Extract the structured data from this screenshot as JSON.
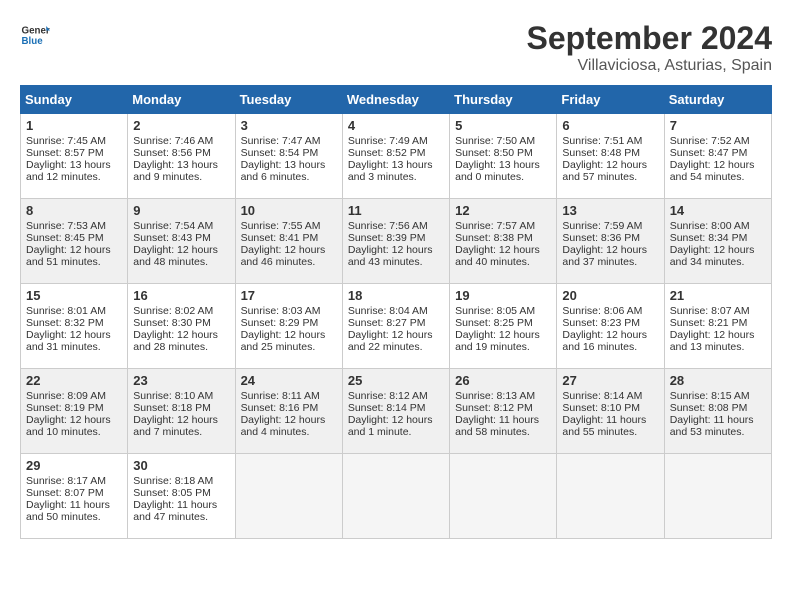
{
  "header": {
    "logo_line1": "General",
    "logo_line2": "Blue",
    "month": "September 2024",
    "location": "Villaviciosa, Asturias, Spain"
  },
  "days_of_week": [
    "Sunday",
    "Monday",
    "Tuesday",
    "Wednesday",
    "Thursday",
    "Friday",
    "Saturday"
  ],
  "weeks": [
    [
      {
        "day": "1",
        "lines": [
          "Sunrise: 7:45 AM",
          "Sunset: 8:57 PM",
          "Daylight: 13 hours",
          "and 12 minutes."
        ]
      },
      {
        "day": "2",
        "lines": [
          "Sunrise: 7:46 AM",
          "Sunset: 8:56 PM",
          "Daylight: 13 hours",
          "and 9 minutes."
        ]
      },
      {
        "day": "3",
        "lines": [
          "Sunrise: 7:47 AM",
          "Sunset: 8:54 PM",
          "Daylight: 13 hours",
          "and 6 minutes."
        ]
      },
      {
        "day": "4",
        "lines": [
          "Sunrise: 7:49 AM",
          "Sunset: 8:52 PM",
          "Daylight: 13 hours",
          "and 3 minutes."
        ]
      },
      {
        "day": "5",
        "lines": [
          "Sunrise: 7:50 AM",
          "Sunset: 8:50 PM",
          "Daylight: 13 hours",
          "and 0 minutes."
        ]
      },
      {
        "day": "6",
        "lines": [
          "Sunrise: 7:51 AM",
          "Sunset: 8:48 PM",
          "Daylight: 12 hours",
          "and 57 minutes."
        ]
      },
      {
        "day": "7",
        "lines": [
          "Sunrise: 7:52 AM",
          "Sunset: 8:47 PM",
          "Daylight: 12 hours",
          "and 54 minutes."
        ]
      }
    ],
    [
      {
        "day": "8",
        "lines": [
          "Sunrise: 7:53 AM",
          "Sunset: 8:45 PM",
          "Daylight: 12 hours",
          "and 51 minutes."
        ]
      },
      {
        "day": "9",
        "lines": [
          "Sunrise: 7:54 AM",
          "Sunset: 8:43 PM",
          "Daylight: 12 hours",
          "and 48 minutes."
        ]
      },
      {
        "day": "10",
        "lines": [
          "Sunrise: 7:55 AM",
          "Sunset: 8:41 PM",
          "Daylight: 12 hours",
          "and 46 minutes."
        ]
      },
      {
        "day": "11",
        "lines": [
          "Sunrise: 7:56 AM",
          "Sunset: 8:39 PM",
          "Daylight: 12 hours",
          "and 43 minutes."
        ]
      },
      {
        "day": "12",
        "lines": [
          "Sunrise: 7:57 AM",
          "Sunset: 8:38 PM",
          "Daylight: 12 hours",
          "and 40 minutes."
        ]
      },
      {
        "day": "13",
        "lines": [
          "Sunrise: 7:59 AM",
          "Sunset: 8:36 PM",
          "Daylight: 12 hours",
          "and 37 minutes."
        ]
      },
      {
        "day": "14",
        "lines": [
          "Sunrise: 8:00 AM",
          "Sunset: 8:34 PM",
          "Daylight: 12 hours",
          "and 34 minutes."
        ]
      }
    ],
    [
      {
        "day": "15",
        "lines": [
          "Sunrise: 8:01 AM",
          "Sunset: 8:32 PM",
          "Daylight: 12 hours",
          "and 31 minutes."
        ]
      },
      {
        "day": "16",
        "lines": [
          "Sunrise: 8:02 AM",
          "Sunset: 8:30 PM",
          "Daylight: 12 hours",
          "and 28 minutes."
        ]
      },
      {
        "day": "17",
        "lines": [
          "Sunrise: 8:03 AM",
          "Sunset: 8:29 PM",
          "Daylight: 12 hours",
          "and 25 minutes."
        ]
      },
      {
        "day": "18",
        "lines": [
          "Sunrise: 8:04 AM",
          "Sunset: 8:27 PM",
          "Daylight: 12 hours",
          "and 22 minutes."
        ]
      },
      {
        "day": "19",
        "lines": [
          "Sunrise: 8:05 AM",
          "Sunset: 8:25 PM",
          "Daylight: 12 hours",
          "and 19 minutes."
        ]
      },
      {
        "day": "20",
        "lines": [
          "Sunrise: 8:06 AM",
          "Sunset: 8:23 PM",
          "Daylight: 12 hours",
          "and 16 minutes."
        ]
      },
      {
        "day": "21",
        "lines": [
          "Sunrise: 8:07 AM",
          "Sunset: 8:21 PM",
          "Daylight: 12 hours",
          "and 13 minutes."
        ]
      }
    ],
    [
      {
        "day": "22",
        "lines": [
          "Sunrise: 8:09 AM",
          "Sunset: 8:19 PM",
          "Daylight: 12 hours",
          "and 10 minutes."
        ]
      },
      {
        "day": "23",
        "lines": [
          "Sunrise: 8:10 AM",
          "Sunset: 8:18 PM",
          "Daylight: 12 hours",
          "and 7 minutes."
        ]
      },
      {
        "day": "24",
        "lines": [
          "Sunrise: 8:11 AM",
          "Sunset: 8:16 PM",
          "Daylight: 12 hours",
          "and 4 minutes."
        ]
      },
      {
        "day": "25",
        "lines": [
          "Sunrise: 8:12 AM",
          "Sunset: 8:14 PM",
          "Daylight: 12 hours",
          "and 1 minute."
        ]
      },
      {
        "day": "26",
        "lines": [
          "Sunrise: 8:13 AM",
          "Sunset: 8:12 PM",
          "Daylight: 11 hours",
          "and 58 minutes."
        ]
      },
      {
        "day": "27",
        "lines": [
          "Sunrise: 8:14 AM",
          "Sunset: 8:10 PM",
          "Daylight: 11 hours",
          "and 55 minutes."
        ]
      },
      {
        "day": "28",
        "lines": [
          "Sunrise: 8:15 AM",
          "Sunset: 8:08 PM",
          "Daylight: 11 hours",
          "and 53 minutes."
        ]
      }
    ],
    [
      {
        "day": "29",
        "lines": [
          "Sunrise: 8:17 AM",
          "Sunset: 8:07 PM",
          "Daylight: 11 hours",
          "and 50 minutes."
        ]
      },
      {
        "day": "30",
        "lines": [
          "Sunrise: 8:18 AM",
          "Sunset: 8:05 PM",
          "Daylight: 11 hours",
          "and 47 minutes."
        ]
      },
      null,
      null,
      null,
      null,
      null
    ]
  ]
}
